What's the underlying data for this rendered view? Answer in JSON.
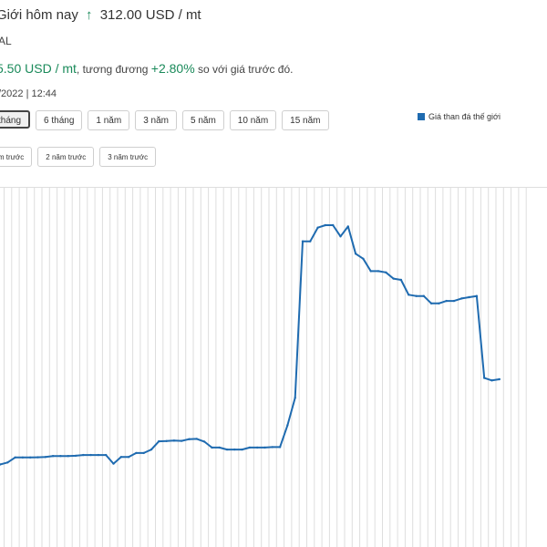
{
  "header": {
    "title": "Giới hôm nay",
    "arrow": "↑",
    "price": "312.00 USD / mt",
    "subtitle": "AL",
    "change_value": "5.50 USD / mt",
    "change_mid": ", tương đương",
    "change_pct": "+2.80%",
    "change_suffix": "so với giá trước đó.",
    "date": "/2022 | 12:44"
  },
  "range_buttons": [
    "tháng",
    "6 tháng",
    "1 năm",
    "3 năm",
    "5 năm",
    "10 năm",
    "15 năm"
  ],
  "compare_buttons": [
    "năm trước",
    "2 năm trước",
    "3 năm trước"
  ],
  "legend": {
    "label": "Giá than đá thế giới",
    "color": "#1f6bb0"
  },
  "colors": {
    "accent_green": "#1a8a5a",
    "line": "#1f6bb0",
    "grid": "#dedede"
  },
  "chart_data": {
    "type": "line",
    "title": "",
    "xlabel": "",
    "ylabel": "",
    "grid": true,
    "legend": "top-right",
    "ylim": [
      0,
      400
    ],
    "series": [
      {
        "name": "Giá than đá thế giới",
        "values": [
          2,
          10,
          30,
          30,
          30,
          31,
          32,
          36,
          36,
          36,
          37,
          40,
          40,
          40,
          40,
          5,
          32,
          32,
          48,
          48,
          62,
          95,
          96,
          98,
          97,
          104,
          105,
          94,
          70,
          70,
          62,
          62,
          62,
          70,
          70,
          70,
          72,
          72,
          160,
          270,
          900,
          900,
          955,
          965,
          965,
          920,
          960,
          850,
          830,
          780,
          780,
          775,
          750,
          745,
          685,
          680,
          680,
          650,
          650,
          660,
          660,
          670,
          675,
          680,
          350,
          340,
          345
        ]
      }
    ]
  }
}
